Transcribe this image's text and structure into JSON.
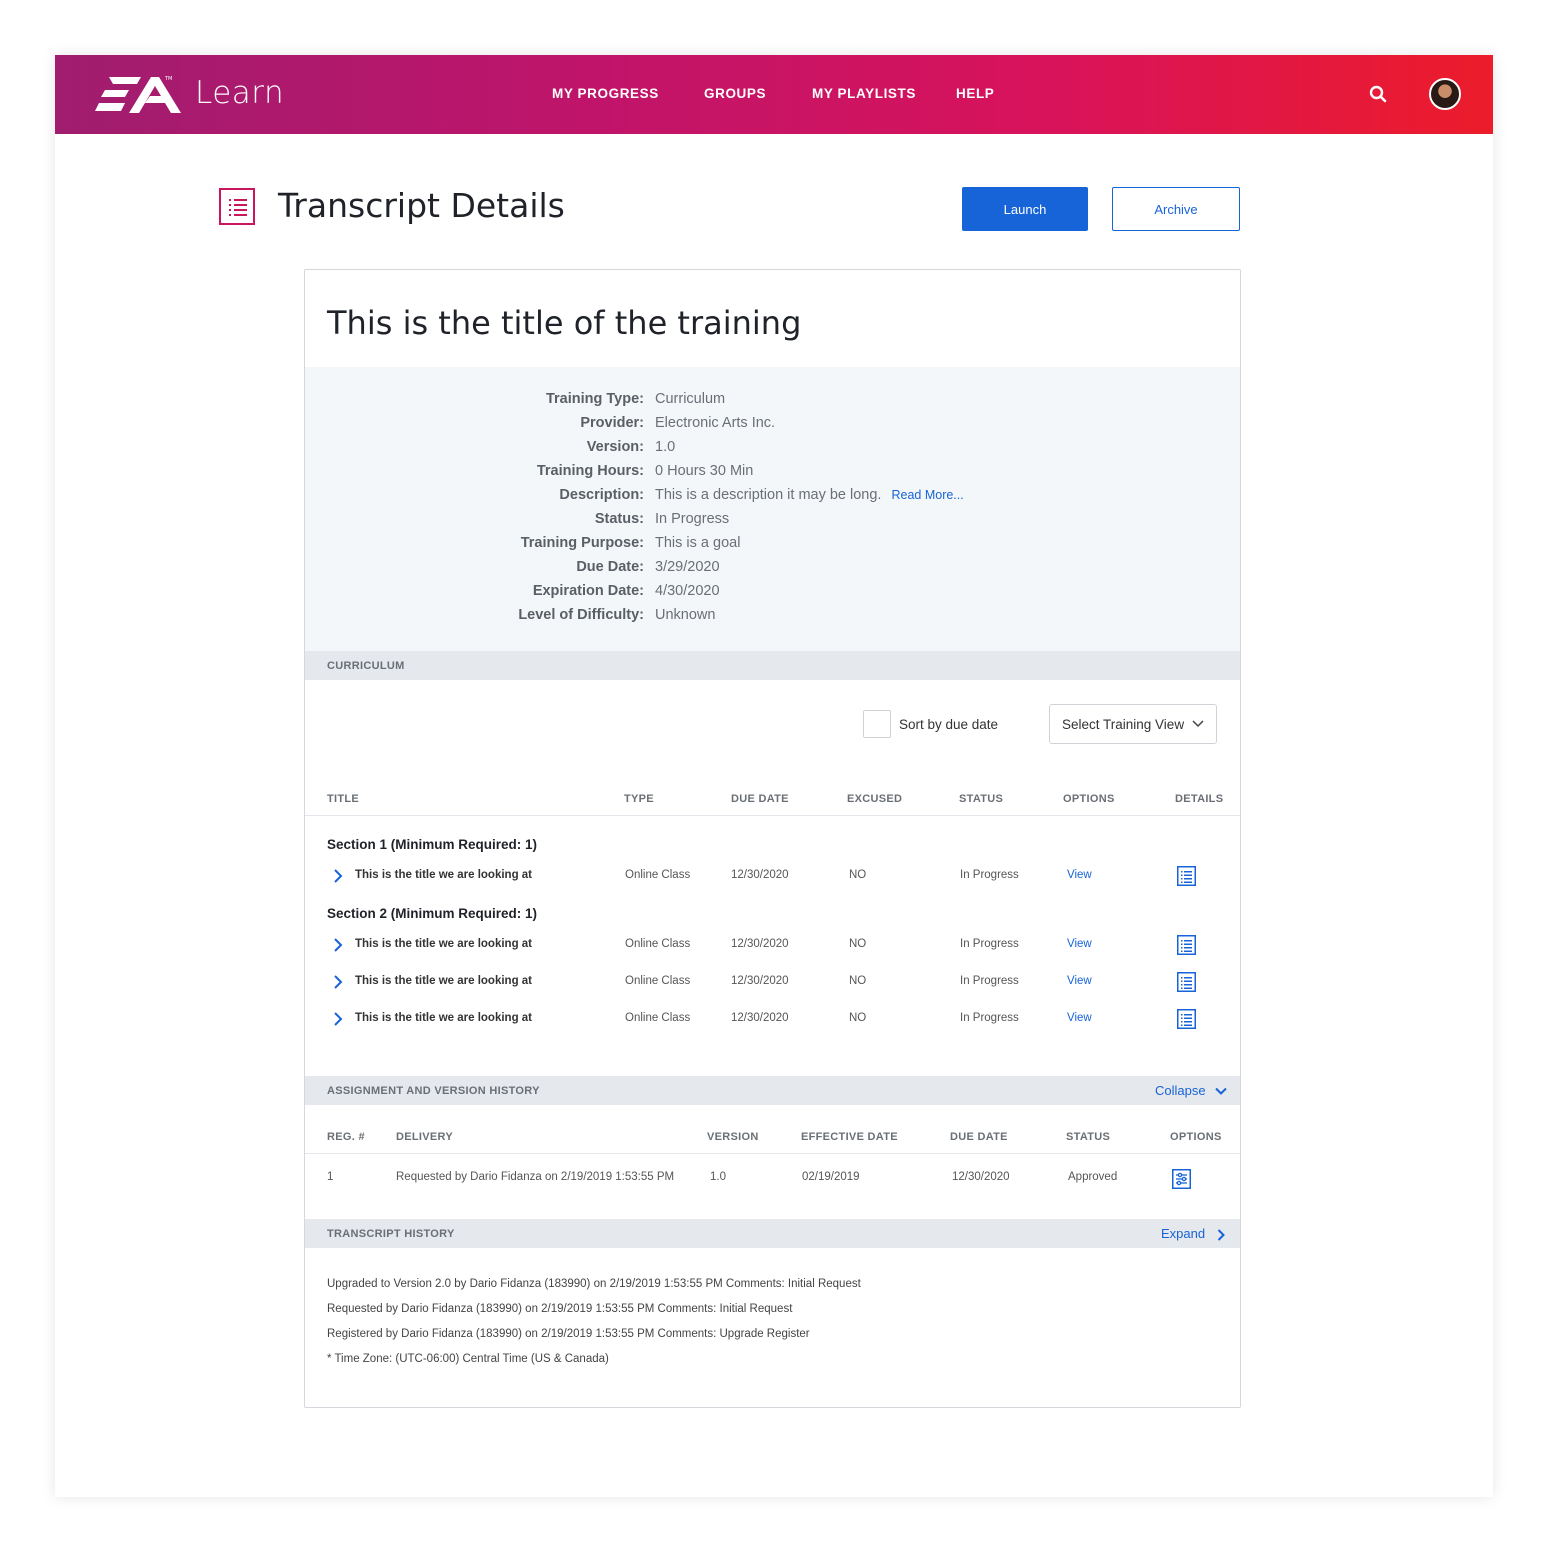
{
  "header": {
    "brand": "Learn",
    "nav": [
      {
        "label": "MY PROGRESS"
      },
      {
        "label": "GROUPS"
      },
      {
        "label": "MY PLAYLISTS"
      },
      {
        "label": "HELP"
      }
    ],
    "search_icon": "search-icon",
    "avatar_icon": "avatar"
  },
  "page": {
    "title": "Transcript Details",
    "title_icon": "transcript-list-icon",
    "launch_label": "Launch",
    "archive_label": "Archive"
  },
  "training": {
    "title": "This is the title of the training",
    "details": [
      {
        "label": "Training Type:",
        "value": "Curriculum"
      },
      {
        "label": "Provider:",
        "value": "Electronic Arts Inc."
      },
      {
        "label": "Version:",
        "value": "1.0"
      },
      {
        "label": "Training Hours:",
        "value": "0 Hours 30 Min"
      },
      {
        "label": "Description:",
        "value": "This is a description it may be long.",
        "link": "Read More..."
      },
      {
        "label": "Status:",
        "value": "In Progress"
      },
      {
        "label": "Training Purpose:",
        "value": "This is a goal"
      },
      {
        "label": "Due Date:",
        "value": "3/29/2020"
      },
      {
        "label": "Expiration Date:",
        "value": "4/30/2020"
      },
      {
        "label": "Level of Difficulty:",
        "value": "Unknown"
      }
    ]
  },
  "curriculum": {
    "section_label": "CURRICULUM",
    "sort_label": "Sort by due date",
    "sort_checked": false,
    "view_select": "Select Training View",
    "columns": [
      "TITLE",
      "TYPE",
      "DUE DATE",
      "EXCUSED",
      "STATUS",
      "OPTIONS",
      "DETAILS"
    ],
    "sections": [
      {
        "heading": "Section 1 (Minimum Required: 1)",
        "rows": [
          {
            "title": "This is the title we are looking at",
            "type": "Online Class",
            "due": "12/30/2020",
            "excused": "NO",
            "status": "In Progress",
            "option": "View"
          }
        ]
      },
      {
        "heading": "Section 2 (Minimum Required: 1)",
        "rows": [
          {
            "title": "This is the title we are looking at",
            "type": "Online Class",
            "due": "12/30/2020",
            "excused": "NO",
            "status": "In Progress",
            "option": "View"
          },
          {
            "title": "This is the title we are looking at",
            "type": "Online Class",
            "due": "12/30/2020",
            "excused": "NO",
            "status": "In Progress",
            "option": "View"
          },
          {
            "title": "This is the title we are looking at",
            "type": "Online Class",
            "due": "12/30/2020",
            "excused": "NO",
            "status": "In Progress",
            "option": "View"
          }
        ]
      }
    ]
  },
  "assignment": {
    "section_label": "ASSIGNMENT AND VERSION HISTORY",
    "toggle_label": "Collapse",
    "columns": [
      "REG. #",
      "DELIVERY",
      "VERSION",
      "EFFECTIVE DATE",
      "DUE DATE",
      "STATUS",
      "OPTIONS"
    ],
    "rows": [
      {
        "reg": "1",
        "delivery": "Requested by Dario Fidanza on 2/19/2019 1:53:55 PM",
        "version": "1.0",
        "effective": "02/19/2019",
        "due": "12/30/2020",
        "status": "Approved"
      }
    ]
  },
  "transcript_history": {
    "section_label": "TRANSCRIPT HISTORY",
    "toggle_label": "Expand",
    "lines": [
      "Upgraded to Version 2.0 by Dario Fidanza (183990) on 2/19/2019 1:53:55 PM Comments: Initial Request",
      "Requested by Dario Fidanza (183990) on 2/19/2019 1:53:55 PM Comments: Initial Request",
      "Registered by Dario Fidanza (183990) on 2/19/2019 1:53:55 PM Comments: Upgrade Register",
      "* Time Zone: (UTC-06:00) Central Time (US & Canada)"
    ]
  },
  "colors": {
    "accent": "#1763d8",
    "brand_gradient_start": "#a01d6f",
    "brand_gradient_end": "#ec1c2a",
    "title_icon": "#c8175c"
  }
}
